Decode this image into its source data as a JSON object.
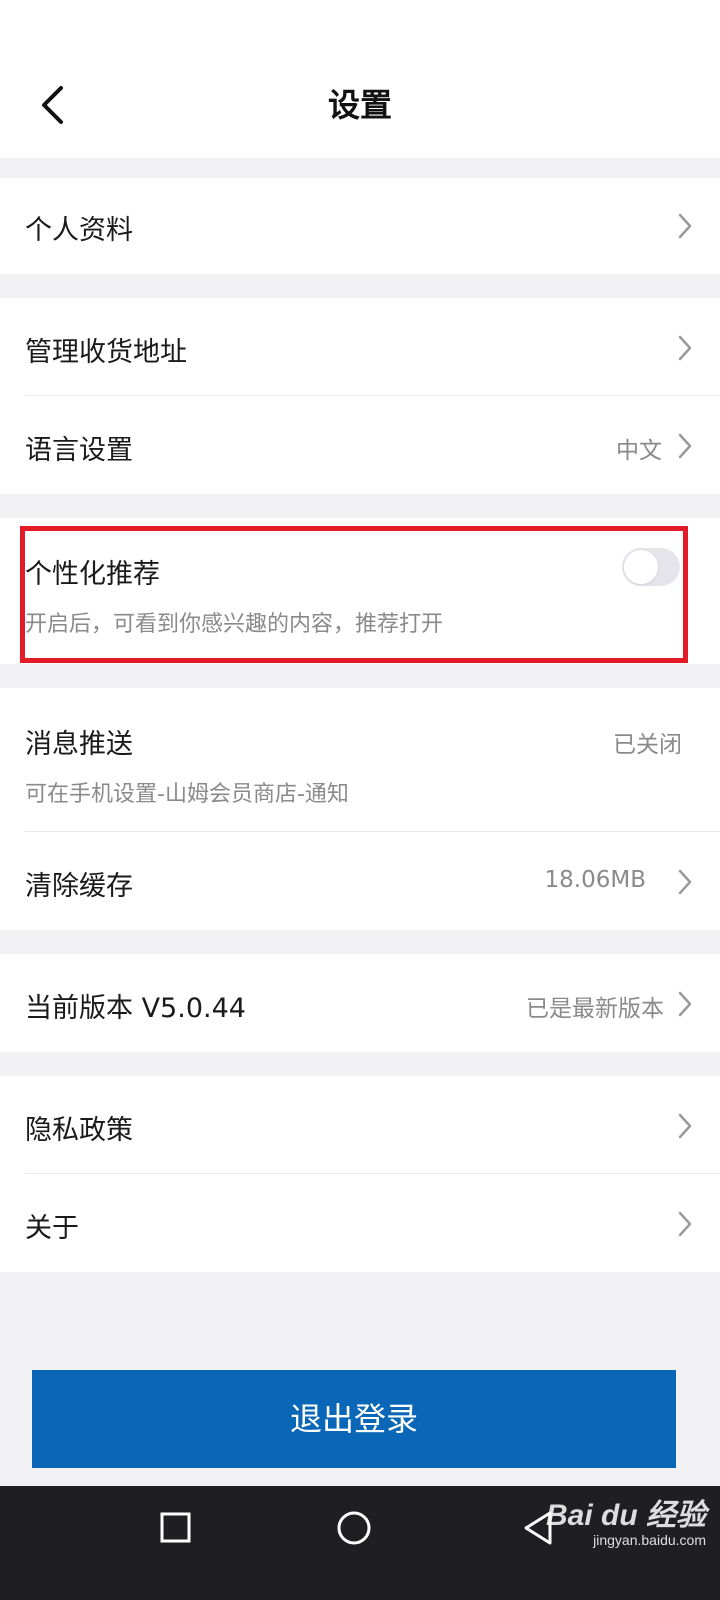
{
  "header": {
    "title": "设置",
    "back_icon": "chevron-left-icon"
  },
  "settings": {
    "profile": {
      "label": "个人资料"
    },
    "address": {
      "label": "管理收货地址"
    },
    "language": {
      "label": "语言设置",
      "value": "中文"
    },
    "personalized": {
      "label": "个性化推荐",
      "description": "开启后，可看到你感兴趣的内容，推荐打开",
      "enabled": false
    },
    "notifications": {
      "label": "消息推送",
      "description": "可在手机设置-山姆会员商店-通知",
      "value": "已关闭"
    },
    "cache": {
      "label": "清除缓存",
      "value": "18.06MB"
    },
    "version": {
      "label": "当前版本 V5.0.44",
      "value": "已是最新版本"
    },
    "privacy": {
      "label": "隐私政策"
    },
    "about": {
      "label": "关于"
    }
  },
  "logout": {
    "label": "退出登录"
  },
  "system_nav": [
    "recents-square-icon",
    "home-circle-icon",
    "back-triangle-icon"
  ],
  "watermark": {
    "brand": "Bai du 经验",
    "url": "jingyan.baidu.com"
  },
  "colors": {
    "accent_button": "#0a67b8",
    "highlight_border": "#e21b26",
    "page_background": "#f2f2f4",
    "nav_bar": "#1f1f23",
    "secondary_text": "#8a8a8a"
  }
}
